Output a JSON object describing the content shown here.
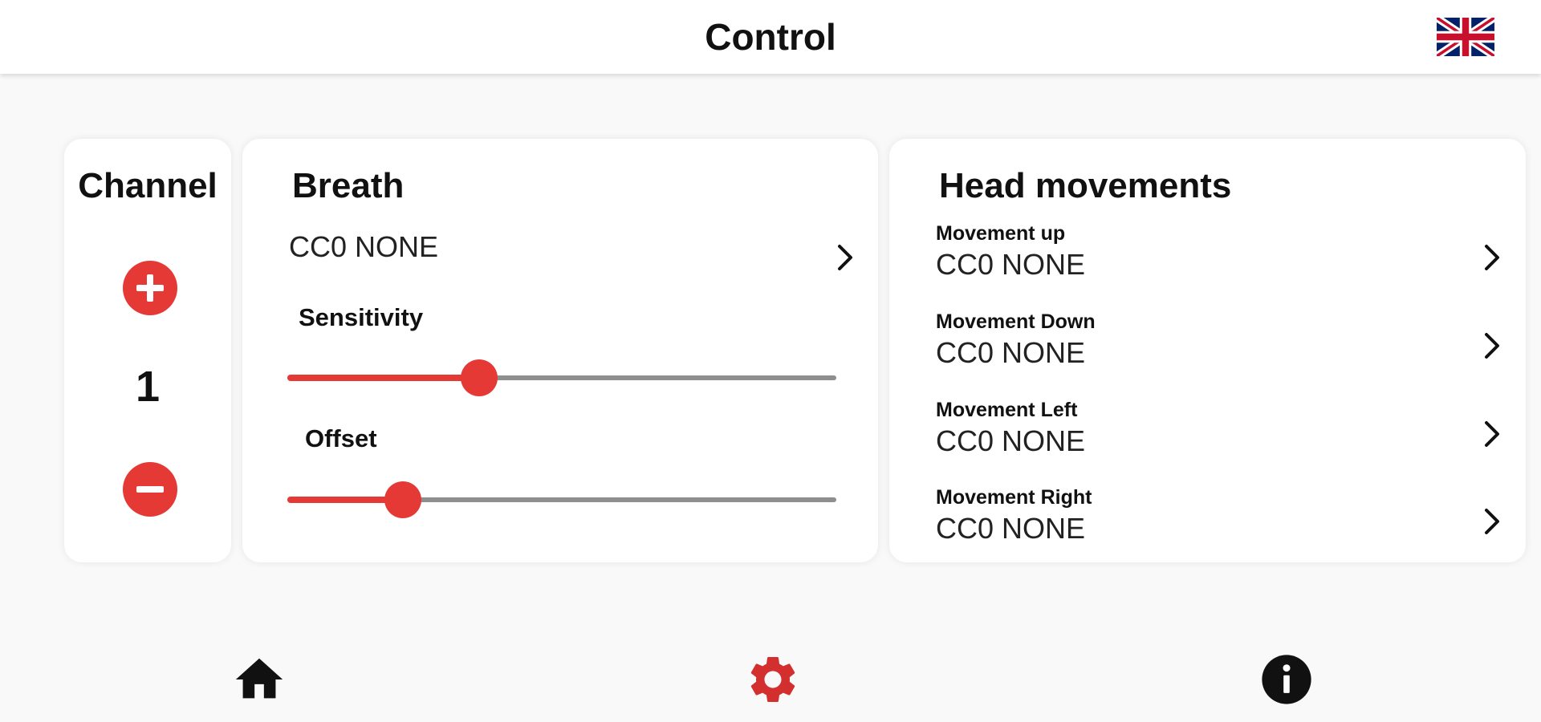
{
  "header": {
    "title": "Control",
    "language_icon": "uk-flag-icon"
  },
  "channel": {
    "title": "Channel",
    "value": "1",
    "increment_icon": "plus-circle-icon",
    "decrement_icon": "minus-circle-icon"
  },
  "breath": {
    "title": "Breath",
    "cc_value": "CC0 NONE",
    "sensitivity": {
      "label": "Sensitivity",
      "value_fraction": 0.35
    },
    "offset": {
      "label": "Offset",
      "value_fraction": 0.21
    }
  },
  "head_movements": {
    "title": "Head movements",
    "items": [
      {
        "label": "Movement up",
        "value": "CC0 NONE"
      },
      {
        "label": "Movement Down",
        "value": "CC0 NONE"
      },
      {
        "label": "Movement Left",
        "value": "CC0 NONE"
      },
      {
        "label": "Movement Right",
        "value": "CC0 NONE"
      }
    ]
  },
  "bottom_nav": {
    "items": [
      {
        "icon": "home-icon",
        "active": false
      },
      {
        "icon": "gear-icon",
        "active": true
      },
      {
        "icon": "info-icon",
        "active": false
      }
    ]
  },
  "colors": {
    "accent": "#e53935",
    "track": "#8e8e8e",
    "text": "#111111"
  }
}
